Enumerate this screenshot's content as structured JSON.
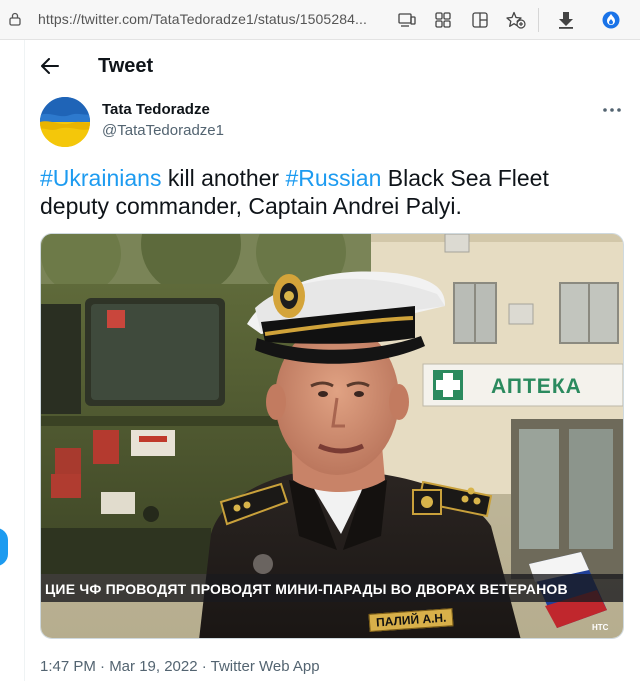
{
  "browser": {
    "url": "https://twitter.com/TataTedoradze1/status/1505284...",
    "icons": [
      "lock-icon",
      "reader-view-icon",
      "app-grid-icon",
      "split-screen-icon",
      "favorite-add-icon",
      "download-icon",
      "browser-extension-icon"
    ]
  },
  "header": {
    "title": "Tweet",
    "back_icon": "back-arrow-icon"
  },
  "author": {
    "display_name": "Tata Tedoradze",
    "handle": "@TataTedoradze1",
    "more_icon": "more-horizontal-icon"
  },
  "tweet": {
    "hashtag1": "#Ukrainians",
    "text1": " kill another ",
    "hashtag2": "#Russian",
    "text2": " Black Sea Fleet deputy commander, Captain Andrei Palyi."
  },
  "media": {
    "caption": "ЦИЕ ЧФ ПРОВОДЯТ ПРОВОДЯТ МИНИ-ПАРАДЫ ВО ДВОРАХ ВЕТЕРАНОВ",
    "sign_text": "АПТЕКА",
    "name_tag": "ПАЛИЙ А.Н.",
    "watermark": "НТС"
  },
  "meta": {
    "timestamp": "1:47 PM · Mar 19, 2022 · Twitter Web App"
  },
  "colors": {
    "accent": "#1d9bf0",
    "text": "#0f1419",
    "secondary": "#536471"
  }
}
